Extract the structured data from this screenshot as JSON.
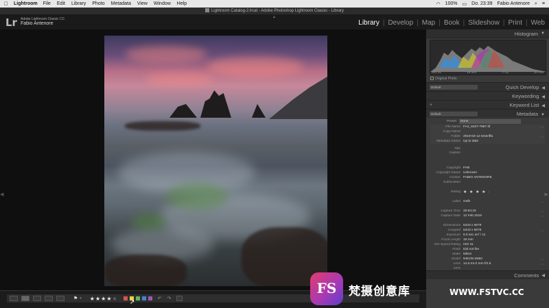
{
  "menubar": {
    "apple_icon": "apple-icon",
    "app_name": "Lightroom",
    "items": [
      "File",
      "Edit",
      "Library",
      "Photo",
      "Metadata",
      "View",
      "Window",
      "Help"
    ],
    "battery": "100%",
    "datetime": "Do. 23:39",
    "user": "Fabio Antenore"
  },
  "titlebar": {
    "title": "Lightroom Catalog-2.lrcat - Adobe Photoshop Lightroom Classic - Library"
  },
  "identity": {
    "logo": "Lr",
    "product": "Adobe Lightroom Classic CC",
    "user": "Fabio Antenore"
  },
  "modules": {
    "items": [
      "Library",
      "Develop",
      "Map",
      "Book",
      "Slideshow",
      "Print",
      "Web"
    ],
    "active": "Library"
  },
  "right_panel": {
    "histogram_label": "Histogram",
    "hist_info": [
      "ISO 31",
      "18 mm",
      "f / 11",
      "6.0 sec"
    ],
    "original_photo": "Original Photo",
    "quick_develop": {
      "preset": "Default",
      "label": "Quick Develop"
    },
    "keywording": "Keywording",
    "keyword_list": "Keyword List",
    "metadata": {
      "preset": "Default",
      "label": "Metadata"
    },
    "comments": "Comments"
  },
  "metadata_fields": {
    "preset_key": "Preset",
    "preset_value": "None",
    "file_name": [
      "File Name",
      "FA2_6437-7987.tif"
    ],
    "copy_name": [
      "Copy Name",
      ""
    ],
    "folder": [
      "Folder",
      "2019-02-12 teneriffa"
    ],
    "metadata_status": [
      "Metadata Status",
      "Up to date"
    ],
    "title": [
      "Title",
      ""
    ],
    "caption": [
      "Caption",
      ""
    ],
    "copyright": [
      "Copyright",
      "FAB"
    ],
    "copyright_status": [
      "Copyright Status",
      "Unknown"
    ],
    "creator": [
      "Creator",
      "FABIO ANTENORE"
    ],
    "sublocation": [
      "Sublocation",
      ""
    ],
    "rating": [
      "Rating",
      "★ ★ ★ ★  ·"
    ],
    "label": [
      "Label",
      "Gelb"
    ],
    "capture_time": [
      "Capture Time",
      "20:54:16"
    ],
    "capture_date": [
      "Capture Date",
      "12 Feb 2019"
    ],
    "dimensions": [
      "Dimensions",
      "5343 x 6679"
    ],
    "cropped": [
      "Cropped",
      "5343 x 6679"
    ],
    "exposure": [
      "Exposure",
      "6.0 sec at f / 11"
    ],
    "focal_length": [
      "Focal Length",
      "18 mm"
    ],
    "iso": [
      "ISO Speed Rating",
      "ISO 31"
    ],
    "flash": [
      "Flash",
      "Did not fire"
    ],
    "make": [
      "Make",
      "Nikon"
    ],
    "model": [
      "Model",
      "NIKON D850"
    ],
    "lens": [
      "Lens",
      "14.0-24.0 mm f/2.8"
    ],
    "gps": [
      "GPS",
      ""
    ]
  },
  "toolbar": {
    "stars": "★★★★",
    "stars_empty": "★",
    "label_colors": [
      "#d9534f",
      "#e8d34a",
      "#5cb85c",
      "#4a7fd0",
      "#9b59b6"
    ],
    "rating_value": 4
  },
  "watermark": {
    "logo": "FS",
    "text": "梵摄创意库",
    "url": "WWW.FSTVC.CC"
  }
}
